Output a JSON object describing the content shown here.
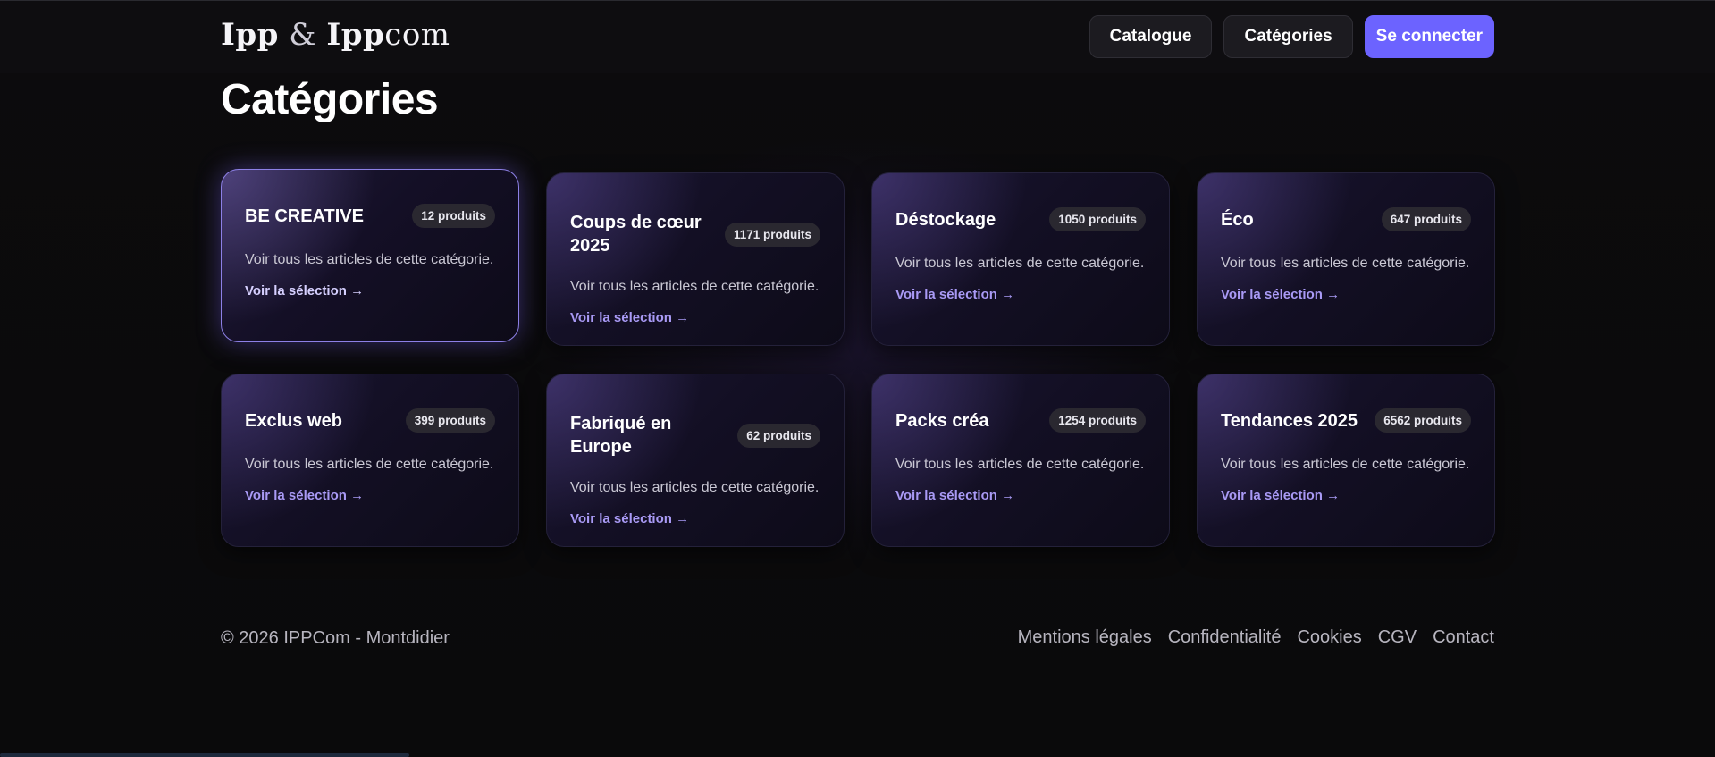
{
  "header": {
    "logo": {
      "part1": "Ipp",
      "amp": "&",
      "part2": "Ipp",
      "part3": "com"
    },
    "nav": [
      {
        "label": "Catalogue"
      },
      {
        "label": "Catégories"
      },
      {
        "label": "Se connecter"
      }
    ]
  },
  "page_title": "Catégories",
  "categories": [
    {
      "title": "BE CREATIVE",
      "count": "12 produits",
      "description": "Voir tous les articles de cette catégorie.",
      "link": "Voir la sélection →"
    },
    {
      "title": "Coups de cœur 2025",
      "count": "1171 produits",
      "description": "Voir tous les articles de cette catégorie.",
      "link": "Voir la sélection →"
    },
    {
      "title": "Déstockage",
      "count": "1050 produits",
      "description": "Voir tous les articles de cette catégorie.",
      "link": "Voir la sélection →"
    },
    {
      "title": "Éco",
      "count": "647 produits",
      "description": "Voir tous les articles de cette catégorie.",
      "link": "Voir la sélection →"
    },
    {
      "title": "Exclus web",
      "count": "399 produits",
      "description": "Voir tous les articles de cette catégorie.",
      "link": "Voir la sélection →"
    },
    {
      "title": "Fabriqué en Europe",
      "count": "62 produits",
      "description": "Voir tous les articles de cette catégorie.",
      "link": "Voir la sélection →"
    },
    {
      "title": "Packs créa",
      "count": "1254 produits",
      "description": "Voir tous les articles de cette catégorie.",
      "link": "Voir la sélection →"
    },
    {
      "title": "Tendances 2025",
      "count": "6562 produits",
      "description": "Voir tous les articles de cette catégorie.",
      "link": "Voir la sélection →"
    }
  ],
  "footer": {
    "copyright": "© 2026 IPPCom - Montdidier",
    "links": [
      {
        "label": "Mentions légales"
      },
      {
        "label": "Confidentialité"
      },
      {
        "label": "Cookies"
      },
      {
        "label": "CGV"
      },
      {
        "label": "Contact"
      }
    ]
  },
  "colors": {
    "background": "#0b0a0c",
    "accent": "#6c63ff",
    "link": "#a99af5",
    "card": "#151129"
  }
}
